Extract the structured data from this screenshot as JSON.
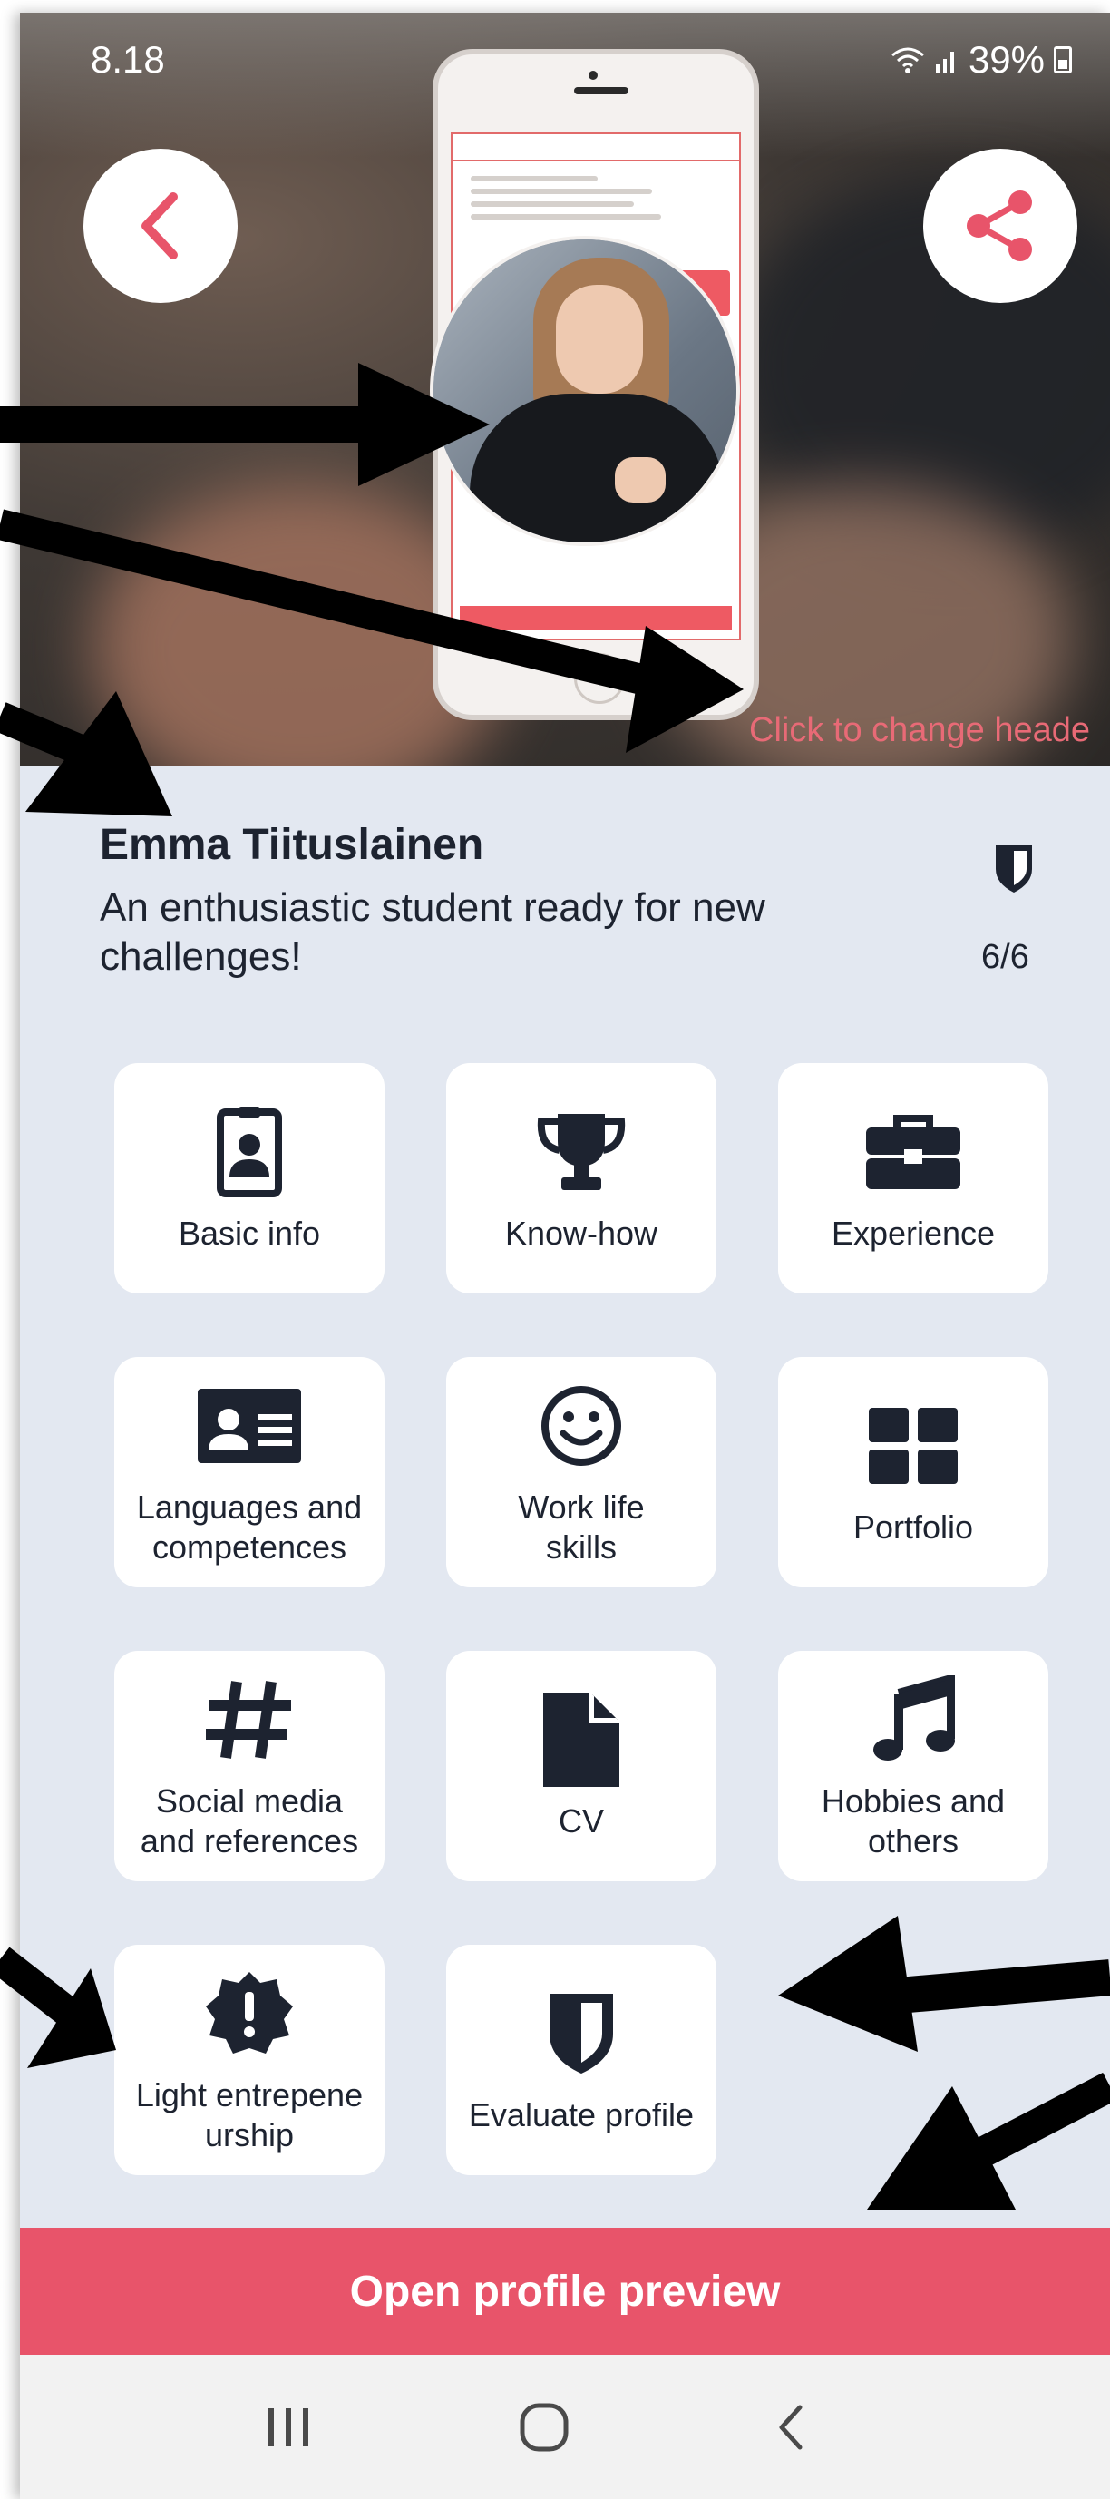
{
  "status_bar": {
    "time": "8.18",
    "battery": "39%",
    "icons": [
      "wifi-icon",
      "signal-icon",
      "battery-icon"
    ]
  },
  "header": {
    "back_icon": "chevron-left-icon",
    "share_icon": "share-icon",
    "change_header_label": "Click to change heade"
  },
  "profile": {
    "name": "Emma Tiituslainen",
    "tagline": "An enthusiastic student ready for new challenges!",
    "badge_icon": "shield-icon",
    "badge_count": "6/6"
  },
  "tiles": [
    {
      "label": "Basic info",
      "icon": "id-badge-icon"
    },
    {
      "label": "Know-how",
      "icon": "trophy-icon"
    },
    {
      "label": "Experience",
      "icon": "briefcase-icon"
    },
    {
      "label": "Languages and\ncompetences",
      "icon": "id-card-icon"
    },
    {
      "label": "Work life\nskills",
      "icon": "smile-icon"
    },
    {
      "label": "Portfolio",
      "icon": "grid-icon"
    },
    {
      "label": "Social media\nand references",
      "icon": "hashtag-icon"
    },
    {
      "label": "CV",
      "icon": "file-icon"
    },
    {
      "label": "Hobbies and\nothers",
      "icon": "music-icon"
    },
    {
      "label": "Light entrepene\nurship",
      "icon": "alert-badge-icon"
    },
    {
      "label": "Evaluate profile",
      "icon": "shield-icon"
    }
  ],
  "open_preview_label": "Open profile preview",
  "nav": {
    "icons": [
      "recent-apps-icon",
      "home-icon",
      "back-icon"
    ]
  },
  "colors": {
    "accent": "#e8546a",
    "background": "#e3e8f1",
    "text": "#1d2330",
    "tile": "#ffffff"
  }
}
